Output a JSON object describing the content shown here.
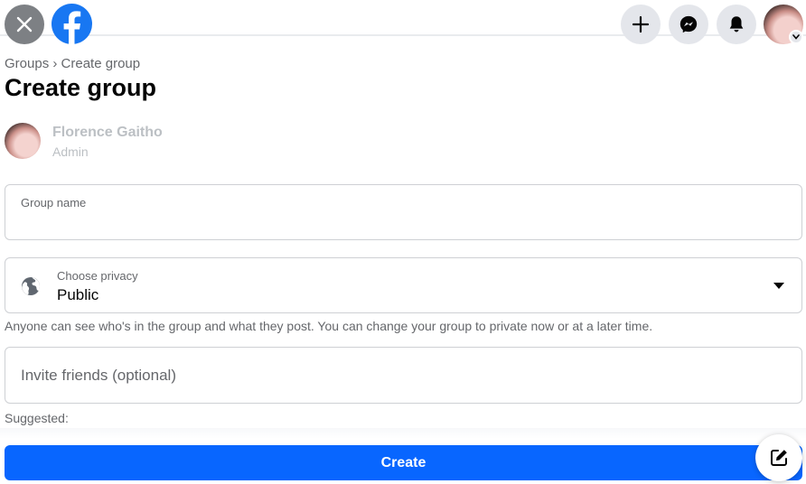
{
  "header": {
    "icons": [
      "close-icon",
      "facebook-logo-icon",
      "plus-icon",
      "messenger-icon",
      "bell-icon",
      "profile-avatar",
      "chevron-down-icon"
    ]
  },
  "breadcrumb": {
    "parent": "Groups",
    "separator": "›",
    "current": "Create group"
  },
  "page": {
    "title": "Create group"
  },
  "admin": {
    "name": "Florence Gaitho",
    "role": "Admin"
  },
  "form": {
    "group_name_label": "Group name",
    "group_name_value": "",
    "privacy_label": "Choose privacy",
    "privacy_value": "Public",
    "privacy_help": "Anyone can see who's in the group and what they post. You can change your group to private now or at a later time.",
    "invite_placeholder": "Invite friends (optional)",
    "suggested_label": "Suggested:"
  },
  "actions": {
    "create_label": "Create"
  },
  "colors": {
    "brand_blue": "#1877f2",
    "button_blue": "#0866ff",
    "secondary_text": "#65676b"
  }
}
